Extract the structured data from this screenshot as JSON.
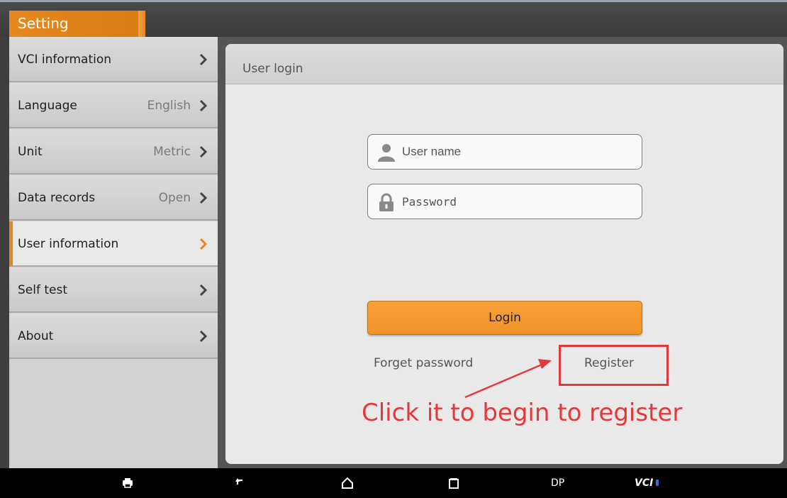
{
  "header": {
    "title": "Setting"
  },
  "sidebar": {
    "items": [
      {
        "label": "VCI information",
        "value": ""
      },
      {
        "label": "Language",
        "value": "English"
      },
      {
        "label": "Unit",
        "value": "Metric"
      },
      {
        "label": "Data records",
        "value": "Open"
      },
      {
        "label": "User information",
        "value": "",
        "active": true
      },
      {
        "label": "Self test",
        "value": ""
      },
      {
        "label": "About",
        "value": ""
      }
    ]
  },
  "login": {
    "panel_title": "User login",
    "username_placeholder": "User name",
    "password_placeholder": "Password",
    "login_label": "Login",
    "forget_password_label": "Forget password",
    "register_label": "Register"
  },
  "annotation": {
    "text": "Click it to begin to register",
    "color": "#e4383a"
  },
  "navbar": {
    "dp_label": "DP",
    "vci_label": "VCI"
  },
  "colors": {
    "accent": "#e8851d",
    "button": "#f19226",
    "annotation": "#e4383a"
  }
}
